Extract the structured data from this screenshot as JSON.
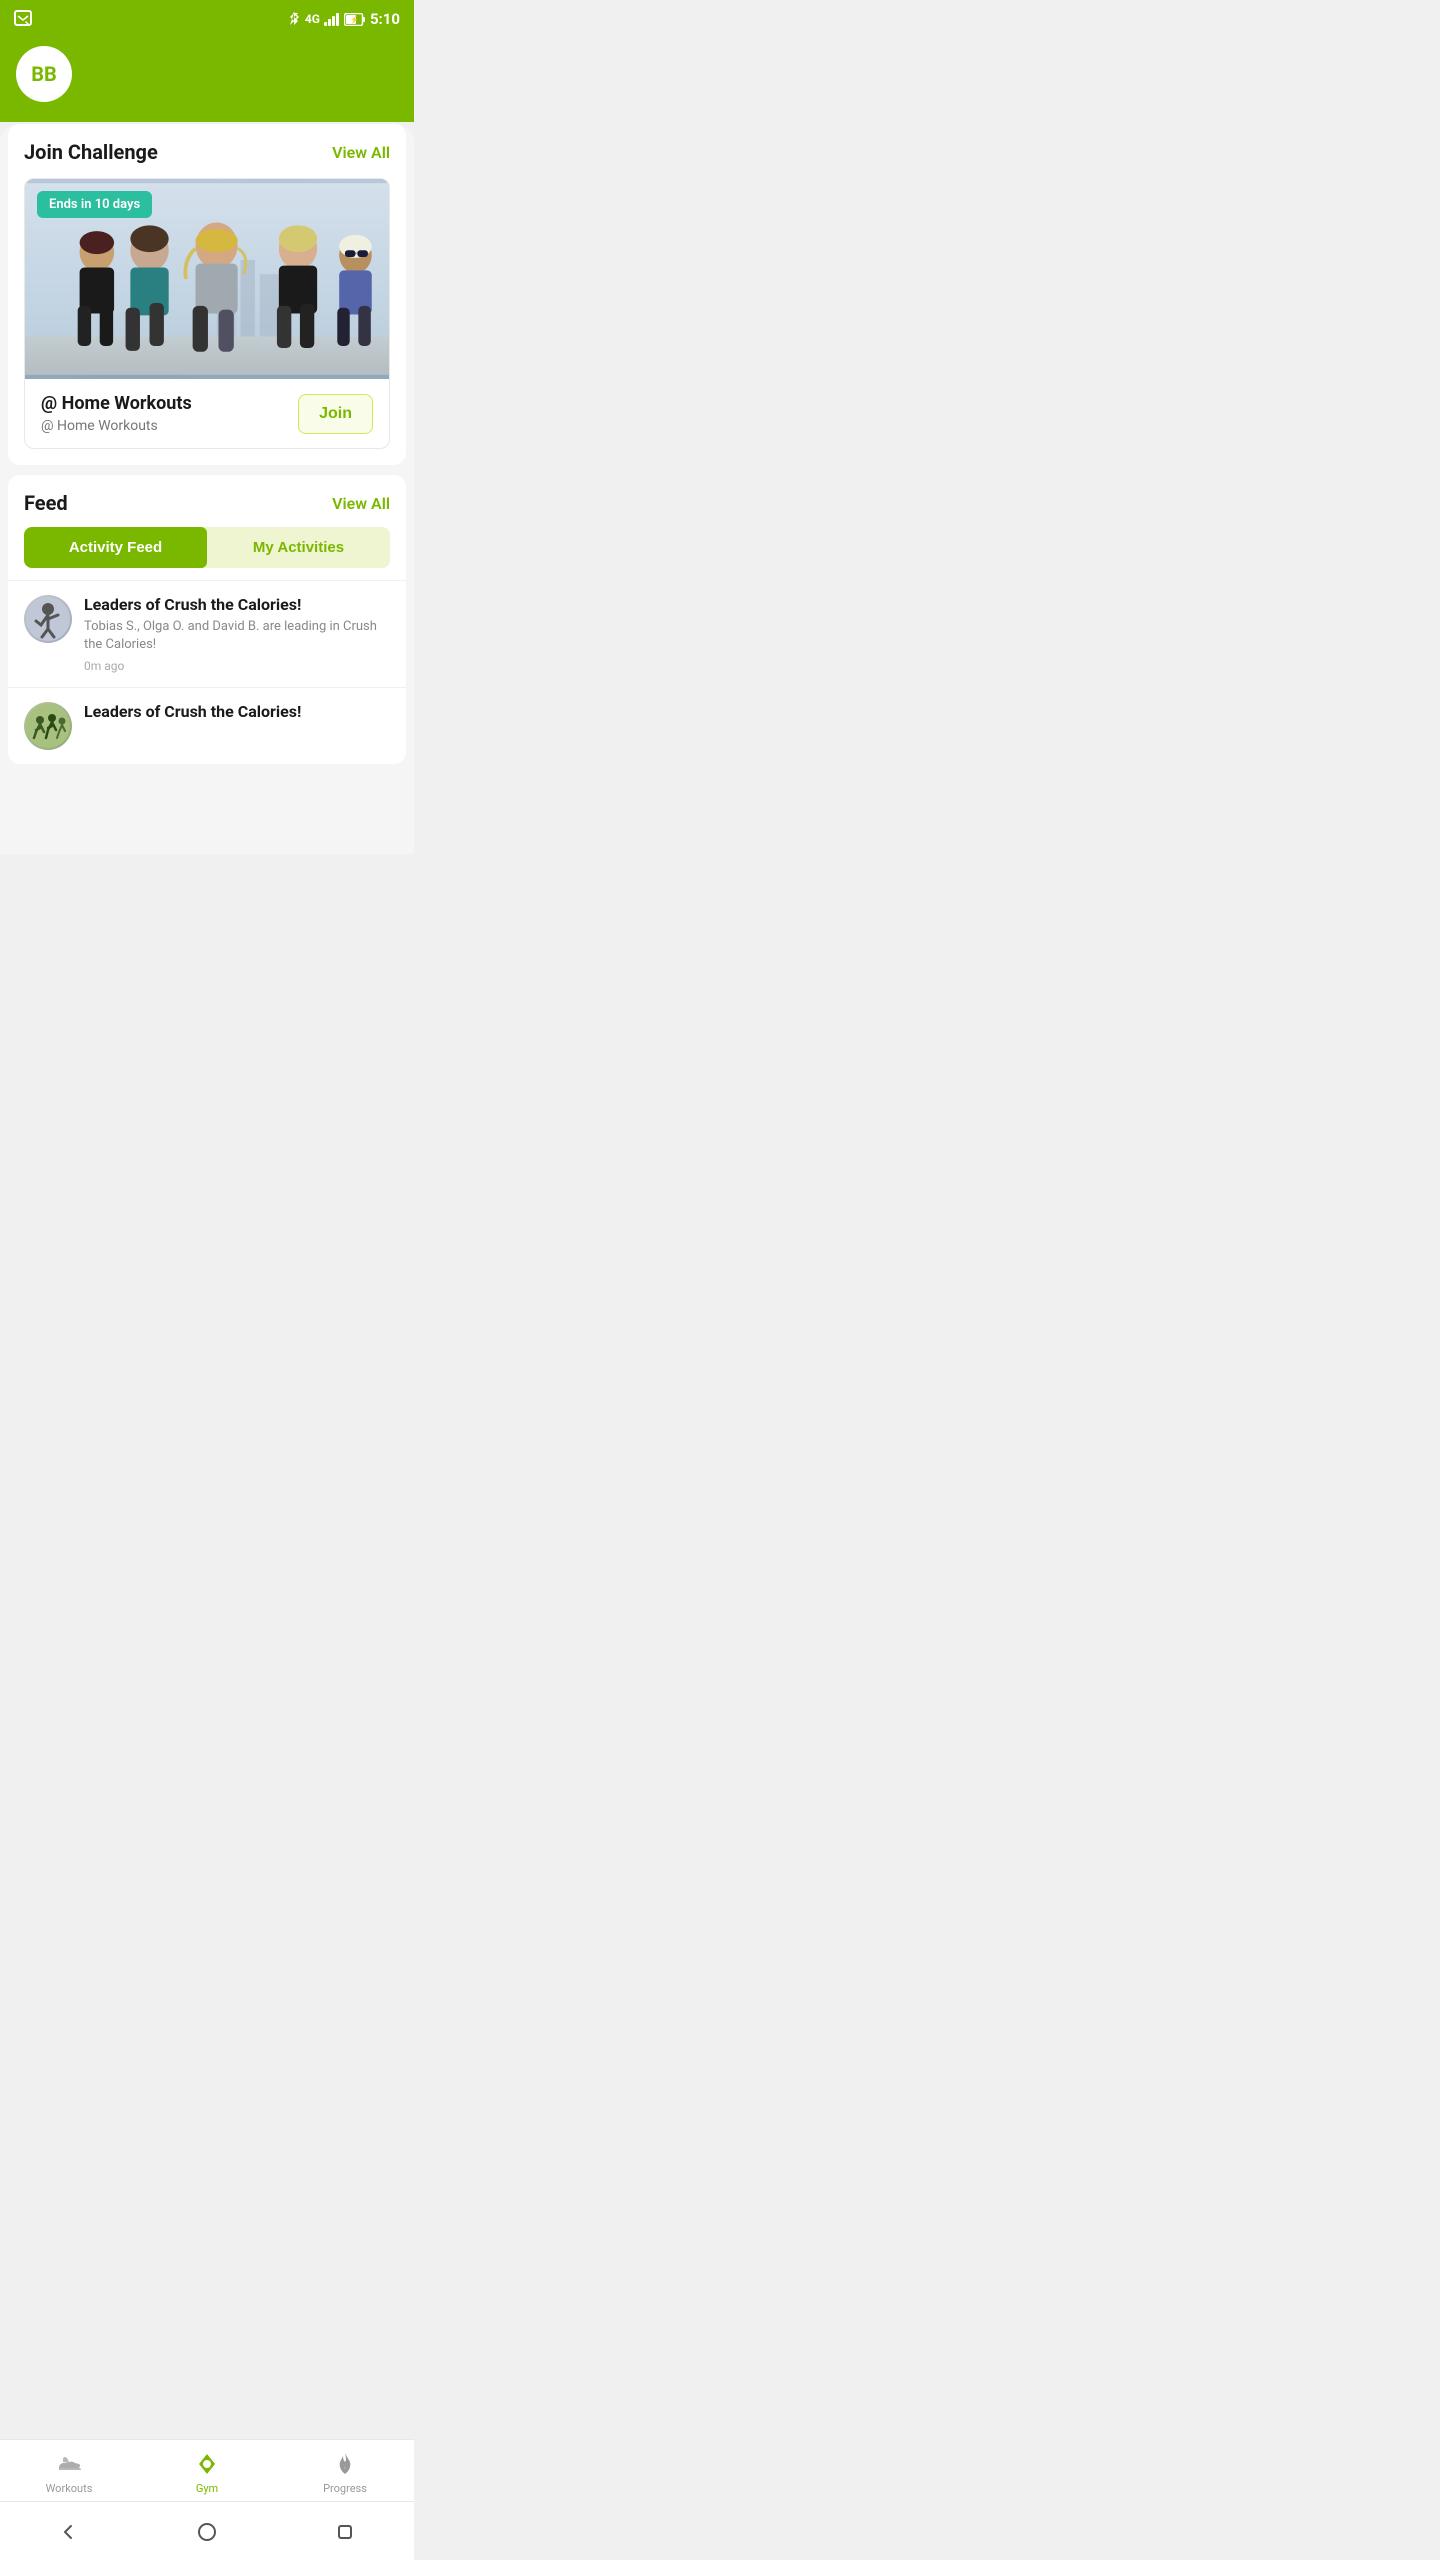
{
  "statusBar": {
    "time": "5:10",
    "networkType": "4G"
  },
  "header": {
    "avatarInitials": "BB"
  },
  "joinChallenge": {
    "sectionTitle": "Join Challenge",
    "viewAllLabel": "View All",
    "endsBadge": "Ends in 10 days",
    "challengeTitle": "@ Home Workouts",
    "challengeSubtitle": "@ Home Workouts",
    "joinButtonLabel": "Join"
  },
  "feed": {
    "sectionTitle": "Feed",
    "viewAllLabel": "View All",
    "tabs": [
      {
        "label": "Activity Feed",
        "active": true
      },
      {
        "label": "My Activities",
        "active": false
      }
    ],
    "items": [
      {
        "title": "Leaders of Crush the Calories!",
        "description": "Tobias S., Olga O. and David B. are leading in Crush the Calories!",
        "time": "0m ago",
        "avatarType": "yoga"
      },
      {
        "title": "Leaders of Crush the Calories!",
        "description": "",
        "time": "",
        "avatarType": "running"
      }
    ]
  },
  "bottomNav": {
    "items": [
      {
        "label": "Workouts",
        "active": false,
        "iconType": "shoe"
      },
      {
        "label": "Gym",
        "active": true,
        "iconType": "diamond"
      },
      {
        "label": "Progress",
        "active": false,
        "iconType": "flame"
      }
    ]
  },
  "androidNav": {
    "buttons": [
      "back",
      "home",
      "recents"
    ]
  }
}
